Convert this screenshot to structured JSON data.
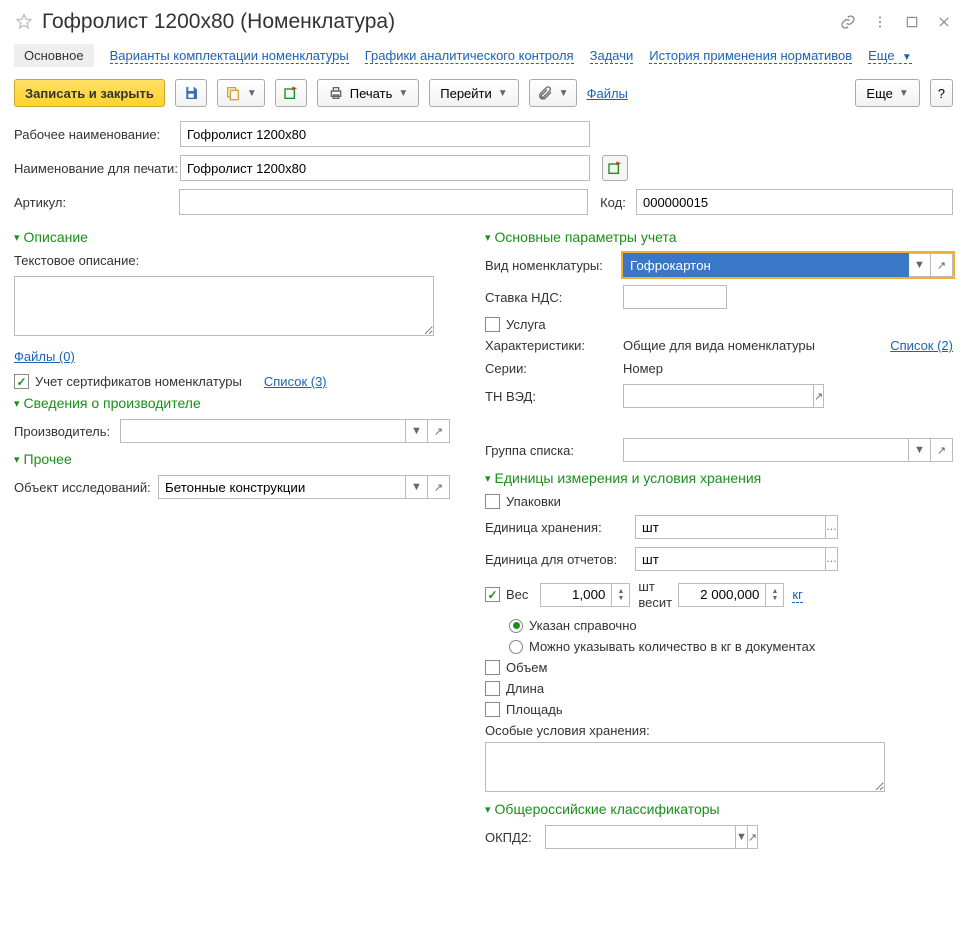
{
  "title": "Гофролист 1200х80 (Номенклатура)",
  "tabs": {
    "main": "Основное",
    "variants": "Варианты комплектации номенклатуры",
    "graphs": "Графики аналитического контроля",
    "tasks": "Задачи",
    "history": "История применения нормативов",
    "more": "Еще"
  },
  "toolbar": {
    "save_close": "Записать и закрыть",
    "print": "Печать",
    "goto": "Перейти",
    "files": "Файлы",
    "more": "Еще",
    "help": "?"
  },
  "fields": {
    "work_name_label": "Рабочее наименование:",
    "work_name_value": "Гофролист 1200х80",
    "print_name_label": "Наименование для печати:",
    "print_name_value": "Гофролист 1200х80",
    "article_label": "Артикул:",
    "article_value": "",
    "code_label": "Код:",
    "code_value": "000000015"
  },
  "left": {
    "desc_head": "Описание",
    "text_desc_label": "Текстовое описание:",
    "files_link": "Файлы (0)",
    "cert_check": "Учет сертификатов номенклатуры",
    "list_link": "Список (3)",
    "manuf_head": "Сведения о производителе",
    "manuf_label": "Производитель:",
    "other_head": "Прочее",
    "obj_label": "Объект исследований:",
    "obj_value": "Бетонные конструкции"
  },
  "right": {
    "params_head": "Основные параметры учета",
    "kind_label": "Вид номенклатуры:",
    "kind_value": "Гофрокартон",
    "vat_label": "Ставка НДС:",
    "service_label": "Услуга",
    "char_label": "Характеристики:",
    "char_value": "Общие для вида номенклатуры",
    "char_link": "Список (2)",
    "series_label": "Серии:",
    "series_value": "Номер",
    "tnved_label": "ТН ВЭД:",
    "group_label": "Группа списка:",
    "units_head": "Единицы измерения и условия хранения",
    "pack_label": "Упаковки",
    "store_unit_label": "Единица хранения:",
    "store_unit_value": "шт",
    "report_unit_label": "Единица для отчетов:",
    "report_unit_value": "шт",
    "weight_check": "Вес",
    "weight_qty": "1,000",
    "weight_mid": "шт весит",
    "weight_val": "2 000,000",
    "weight_unit": "кг",
    "radio1": "Указан справочно",
    "radio2": "Можно указывать количество в кг в документах",
    "vol_label": "Объем",
    "len_label": "Длина",
    "area_label": "Площадь",
    "special_label": "Особые условия хранения:",
    "class_head": "Общероссийские классификаторы",
    "okpd_label": "ОКПД2:"
  }
}
